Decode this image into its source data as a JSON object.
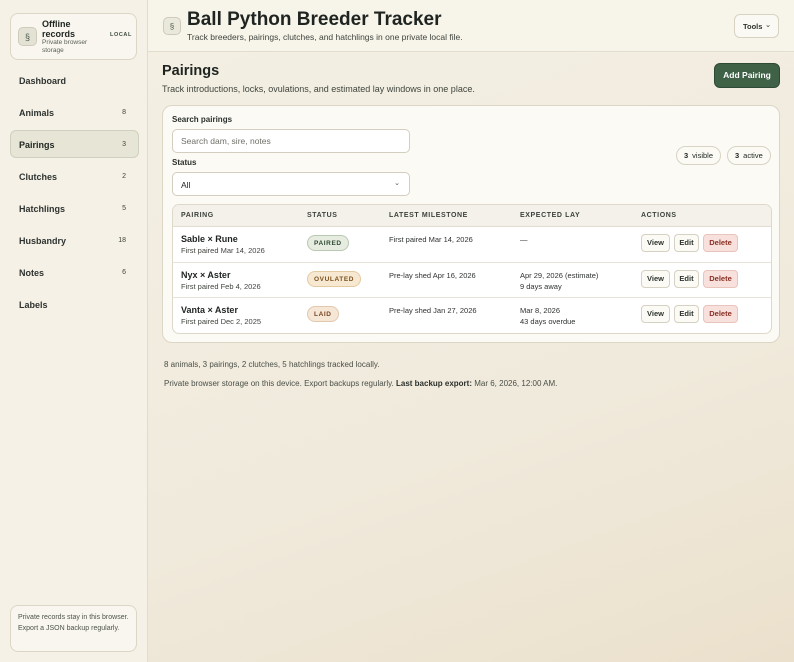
{
  "sidebar": {
    "brand": {
      "icon": "snake-icon",
      "title": "Offline records",
      "subtitle": "Private browser storage",
      "badge": "LOCAL"
    },
    "items": [
      {
        "label": "Dashboard",
        "count": ""
      },
      {
        "label": "Animals",
        "count": "8"
      },
      {
        "label": "Pairings",
        "count": "3",
        "active": true
      },
      {
        "label": "Clutches",
        "count": "2"
      },
      {
        "label": "Hatchlings",
        "count": "5"
      },
      {
        "label": "Husbandry",
        "count": "18"
      },
      {
        "label": "Notes",
        "count": "6"
      },
      {
        "label": "Labels",
        "count": ""
      }
    ],
    "note": "Private records stay in this browser. Export a JSON backup regularly."
  },
  "header": {
    "title": "Ball Python Breeder Tracker",
    "subtitle": "Track breeders, pairings, clutches, and hatchlings in one private local file.",
    "tools_label": "Tools"
  },
  "page": {
    "title": "Pairings",
    "subtitle": "Track introductions, locks, ovulations, and estimated lay windows in one place.",
    "add_label": "Add Pairing"
  },
  "filters": {
    "search_label": "Search pairings",
    "search_placeholder": "Search dam, sire, notes",
    "status_label": "Status",
    "status_value": "All",
    "visible_count": "3",
    "visible_label": "visible",
    "active_count": "3",
    "active_label": "active"
  },
  "table": {
    "headers": [
      "PAIRING",
      "STATUS",
      "LATEST MILESTONE",
      "EXPECTED LAY",
      "ACTIONS"
    ],
    "actions": {
      "view": "View",
      "edit": "Edit",
      "delete": "Delete"
    },
    "rows": [
      {
        "name": "Sable × Rune",
        "sub": "First paired Mar 14, 2026",
        "status": "PAIRED",
        "milestone": "First paired Mar 14, 2026",
        "lay1": "—",
        "lay2": ""
      },
      {
        "name": "Nyx × Aster",
        "sub": "First paired Feb 4, 2026",
        "status": "OVULATED",
        "milestone": "Pre-lay shed Apr 16, 2026",
        "lay1": "Apr 29, 2026 (estimate)",
        "lay2": "9 days away"
      },
      {
        "name": "Vanta × Aster",
        "sub": "First paired Dec 2, 2025",
        "status": "LAID",
        "milestone": "Pre-lay shed Jan 27, 2026",
        "lay1": "Mar 8, 2026",
        "lay2": "43 days overdue"
      }
    ]
  },
  "footer": {
    "summary": "8 animals, 3 pairings, 2 clutches, 5 hatchlings tracked locally.",
    "storage_note": "Private browser storage on this device. Export backups regularly.",
    "backup_label": "Last backup export:",
    "backup_value": "Mar 6, 2026, 12:00 AM."
  },
  "colors": {
    "accent": "#3f6146",
    "paired_bg": "#e6ece0",
    "paired_border": "#b9c8b0",
    "paired_text": "#2f4a32",
    "ovulated_bg": "#f7e8d2",
    "ovulated_border": "#e3c9a0",
    "ovulated_text": "#7a4f1c",
    "laid_bg": "#f6e6d6",
    "laid_border": "#e3c7ad",
    "laid_text": "#7a4422"
  }
}
